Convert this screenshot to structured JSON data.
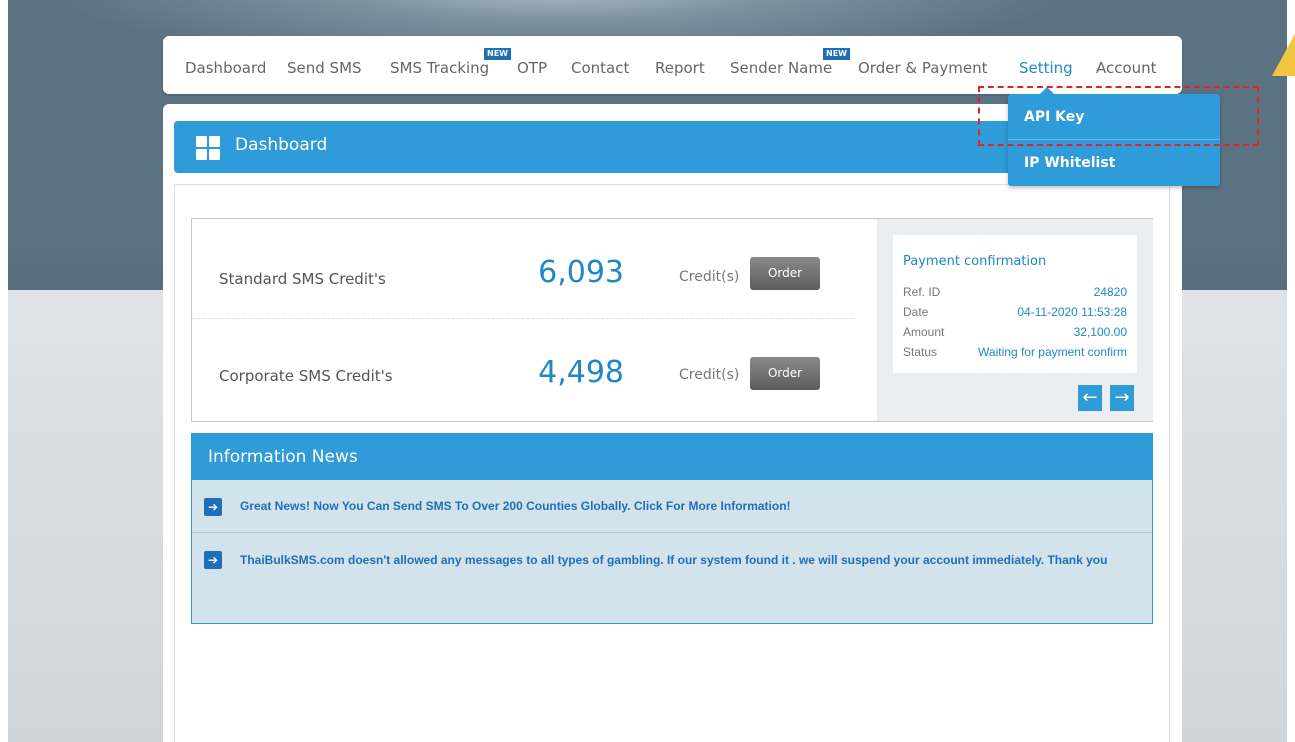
{
  "nav": {
    "items": [
      {
        "label": "Dashboard"
      },
      {
        "label": "Send SMS"
      },
      {
        "label": "SMS Tracking",
        "badge": "NEW"
      },
      {
        "label": "OTP"
      },
      {
        "label": "Contact"
      },
      {
        "label": "Report"
      },
      {
        "label": "Sender Name",
        "badge": "NEW"
      },
      {
        "label": "Order & Payment"
      },
      {
        "label": "Setting",
        "active": true
      },
      {
        "label": "Account"
      }
    ]
  },
  "setting_menu": {
    "items": [
      {
        "label": "API Key"
      },
      {
        "label": "IP Whitelist"
      }
    ]
  },
  "dashboard": {
    "title": "Dashboard"
  },
  "credits": {
    "standard": {
      "label": "Standard SMS Credit's",
      "value": "6,093",
      "unit": "Credit(s)",
      "button": "Order"
    },
    "corporate": {
      "label": "Corporate SMS Credit's",
      "value": "4,498",
      "unit": "Credit(s)",
      "button": "Order"
    }
  },
  "payment": {
    "title": "Payment confirmation",
    "rows": [
      {
        "key": "Ref. ID",
        "value": "24820"
      },
      {
        "key": "Date",
        "value": "04-11-2020 11:53:28"
      },
      {
        "key": "Amount",
        "value": "32,100.00"
      },
      {
        "key": "Status",
        "value": "Waiting for payment confirm"
      }
    ],
    "prev_icon": "←",
    "next_icon": "→"
  },
  "news": {
    "title": "Information News",
    "items": [
      {
        "text": "Great News! Now You Can Send SMS To Over 200 Counties Globally. Click For More Information!"
      },
      {
        "text": "ThaiBulkSMS.com doesn't allowed any messages to all types of gambling. If our system found it . we will suspend your account immediately. Thank you"
      }
    ]
  },
  "colors": {
    "accent": "#2f9bd8",
    "highlight": "#e02424"
  }
}
